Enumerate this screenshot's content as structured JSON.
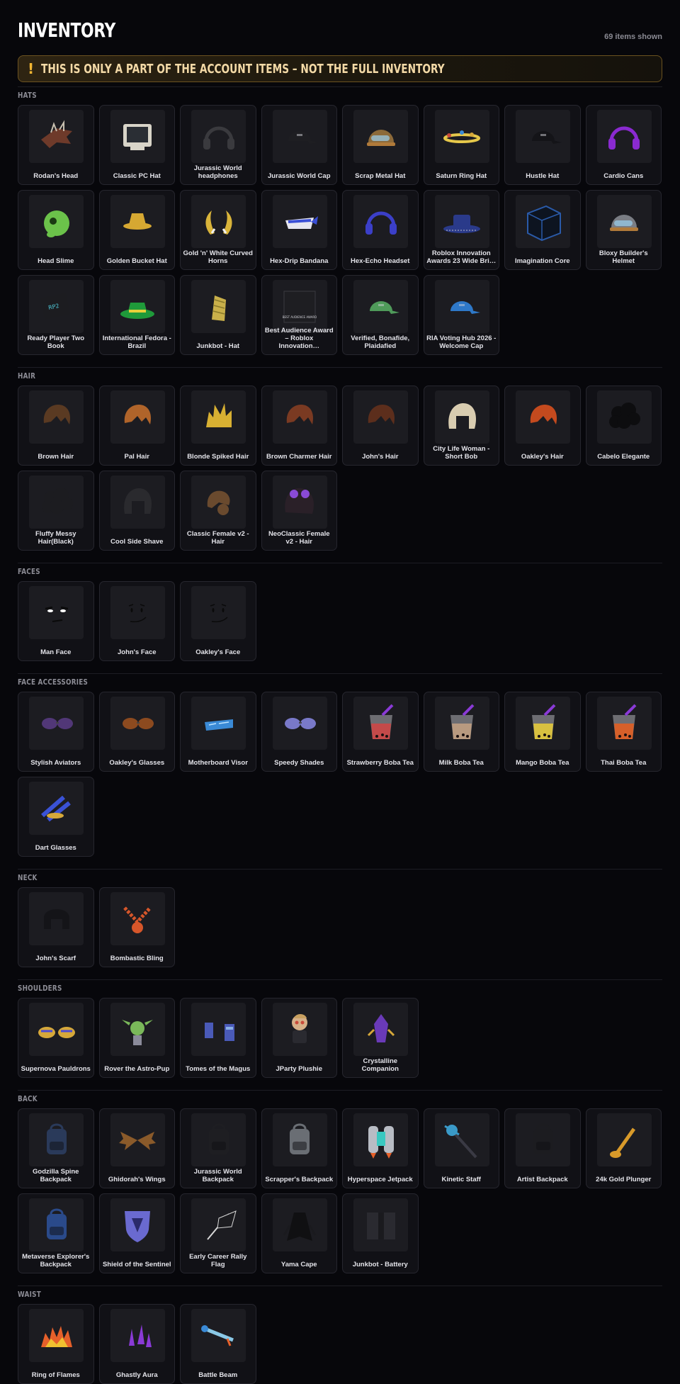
{
  "header": {
    "title": "INVENTORY",
    "count": "69 items shown"
  },
  "warning": {
    "icon": "exclamation-icon",
    "mark": "!",
    "text": "THIS IS ONLY A PART OF THE ACCOUNT ITEMS – NOT THE FULL INVENTORY",
    "accent": "#f2b632"
  },
  "sections": [
    {
      "label": "HATS",
      "items": [
        {
          "name": "Rodan's Head",
          "icon": "creature-head",
          "color": "#6e3a2a"
        },
        {
          "name": "Classic PC Hat",
          "icon": "monitor",
          "color": "#d8d4c8"
        },
        {
          "name": "Jurassic World headphones",
          "icon": "headphones",
          "color": "#3a3a3e"
        },
        {
          "name": "Jurassic World Cap",
          "icon": "cap",
          "color": "#1e1e22"
        },
        {
          "name": "Scrap Metal Hat",
          "icon": "helmet",
          "color": "#8c6a3a"
        },
        {
          "name": "Saturn Ring Hat",
          "icon": "ring",
          "color": "#e6c84a"
        },
        {
          "name": "Hustle Hat",
          "icon": "cap",
          "color": "#141418"
        },
        {
          "name": "Cardio Cans",
          "icon": "headphones",
          "color": "#8a2ad0"
        },
        {
          "name": "Head Slime",
          "icon": "blob",
          "color": "#6bc24a"
        },
        {
          "name": "Golden Bucket Hat",
          "icon": "bucket-hat",
          "color": "#d6a832"
        },
        {
          "name": "Gold 'n' White Curved Horns",
          "icon": "horns",
          "color": "#d9b43a"
        },
        {
          "name": "Hex-Drip Bandana",
          "icon": "bandana",
          "color": "#3a4fd6"
        },
        {
          "name": "Hex-Echo Headset",
          "icon": "headphones",
          "color": "#3b3fc8"
        },
        {
          "name": "Roblox Innovation Awards 23 Wide Bri…",
          "icon": "wide-hat",
          "color": "#2a3a8a"
        },
        {
          "name": "Imagination Core",
          "icon": "cube",
          "color": "#2a5aa8"
        },
        {
          "name": "Bloxy Builder's Helmet",
          "icon": "helmet",
          "color": "#7a7d84"
        },
        {
          "name": "Ready Player Two Book",
          "icon": "book",
          "color": "#4ec7d6"
        },
        {
          "name": "International Fedora - Brazil",
          "icon": "fedora",
          "color": "#1f9a3a"
        },
        {
          "name": "Junkbot - Hat",
          "icon": "junk-hat",
          "color": "#c9b04a"
        },
        {
          "name": "Best Audience Award – Roblox Innovation…",
          "icon": "award-box",
          "color": "#1e1e22"
        },
        {
          "name": "Verified, Bonafide, Plaidafied",
          "icon": "cap",
          "color": "#4f9a5a"
        },
        {
          "name": "RIA Voting Hub 2026 - Welcome Cap",
          "icon": "cap",
          "color": "#2e78c8"
        }
      ]
    },
    {
      "label": "HAIR",
      "items": [
        {
          "name": "Brown Hair",
          "icon": "hair",
          "color": "#5a3a22"
        },
        {
          "name": "Pal Hair",
          "icon": "hair",
          "color": "#b0642a"
        },
        {
          "name": "Blonde Spiked Hair",
          "icon": "hair-spiked",
          "color": "#d8b032"
        },
        {
          "name": "Brown Charmer Hair",
          "icon": "hair",
          "color": "#7a3a22"
        },
        {
          "name": "John's Hair",
          "icon": "hair",
          "color": "#5c2e1c"
        },
        {
          "name": "City Life Woman - Short Bob",
          "icon": "hair-bob",
          "color": "#d8ccb0"
        },
        {
          "name": "Oakley's Hair",
          "icon": "hair",
          "color": "#c44a1e"
        },
        {
          "name": "Cabelo Elegante",
          "icon": "hair-curly",
          "color": "#0d0d0f"
        },
        {
          "name": "Fluffy Messy Hair(Black)",
          "icon": "hair-curly",
          "color": "#1c1c20"
        },
        {
          "name": "Cool Side Shave",
          "icon": "hair-bob",
          "color": "#2a2a2e"
        },
        {
          "name": "Classic Female v2 - Hair",
          "icon": "hair-bun",
          "color": "#6a4a2e"
        },
        {
          "name": "NeoClassic Female v2 - Hair",
          "icon": "hair-glasses",
          "color": "#2a2028"
        }
      ]
    },
    {
      "label": "FACES",
      "items": [
        {
          "name": "Man Face",
          "icon": "face-man",
          "color": "#0e0e10"
        },
        {
          "name": "John's Face",
          "icon": "face-smile",
          "color": "#0e0e10"
        },
        {
          "name": "Oakley's Face",
          "icon": "face-smile",
          "color": "#0e0e10"
        }
      ]
    },
    {
      "label": "FACE ACCESSORIES",
      "items": [
        {
          "name": "Stylish Aviators",
          "icon": "glasses",
          "color": "#5a3c86"
        },
        {
          "name": "Oakley's Glasses",
          "icon": "glasses",
          "color": "#a0521e"
        },
        {
          "name": "Motherboard Visor",
          "icon": "visor",
          "color": "#3a8ad6"
        },
        {
          "name": "Speedy Shades",
          "icon": "glasses",
          "color": "#8a8ae6"
        },
        {
          "name": "Strawberry Boba Tea",
          "icon": "boba",
          "color": "#c44a4a"
        },
        {
          "name": "Milk Boba Tea",
          "icon": "boba",
          "color": "#b89a80"
        },
        {
          "name": "Mango Boba Tea",
          "icon": "boba",
          "color": "#d8c040"
        },
        {
          "name": "Thai Boba Tea",
          "icon": "boba",
          "color": "#d6602a"
        },
        {
          "name": "Dart Glasses",
          "icon": "darts",
          "color": "#3a52d6"
        }
      ]
    },
    {
      "label": "NECK",
      "items": [
        {
          "name": "John's Scarf",
          "icon": "scarf",
          "color": "#141418"
        },
        {
          "name": "Bombastic Bling",
          "icon": "chain",
          "color": "#d6562a"
        }
      ]
    },
    {
      "label": "SHOULDERS",
      "items": [
        {
          "name": "Supernova Pauldrons",
          "icon": "pauldrons",
          "color": "#d6a83a"
        },
        {
          "name": "Rover the Astro-Pup",
          "icon": "pet",
          "color": "#7ab85a"
        },
        {
          "name": "Tomes of the Magus",
          "icon": "books",
          "color": "#4a5ab8"
        },
        {
          "name": "JParty Plushie",
          "icon": "plushie",
          "color": "#c8a060"
        },
        {
          "name": "Crystalline Companion",
          "icon": "crystal-pet",
          "color": "#6a3ab8"
        }
      ]
    },
    {
      "label": "BACK",
      "items": [
        {
          "name": "Godzilla Spine Backpack",
          "icon": "backpack",
          "color": "#2a3a5a"
        },
        {
          "name": "Ghidorah's Wings",
          "icon": "wings",
          "color": "#8a5a2a"
        },
        {
          "name": "Jurassic World Backpack",
          "icon": "backpack",
          "color": "#1e1e22"
        },
        {
          "name": "Scrapper's Backpack",
          "icon": "backpack",
          "color": "#6a6e74"
        },
        {
          "name": "Hyperspace Jetpack",
          "icon": "jetpack",
          "color": "#b8bcc4"
        },
        {
          "name": "Kinetic Staff",
          "icon": "staff",
          "color": "#3a9ac8"
        },
        {
          "name": "Artist Backpack",
          "icon": "backpack",
          "color": "#1c1c20"
        },
        {
          "name": "24k Gold Plunger",
          "icon": "plunger",
          "color": "#d89a2a"
        },
        {
          "name": "Metaverse Explorer's Backpack",
          "icon": "backpack",
          "color": "#2a4a8a"
        },
        {
          "name": "Shield of the Sentinel",
          "icon": "shield",
          "color": "#6a6ad0"
        },
        {
          "name": "Early Career Rally Flag",
          "icon": "flag",
          "color": "#d8d8d8"
        },
        {
          "name": "Yama Cape",
          "icon": "cape",
          "color": "#101012"
        },
        {
          "name": "Junkbot - Battery",
          "icon": "battery",
          "color": "#1a1a1e"
        }
      ]
    },
    {
      "label": "WAIST",
      "items": [
        {
          "name": "Ring of Flames",
          "icon": "flames",
          "color": "#e6602a"
        },
        {
          "name": "Ghastly Aura",
          "icon": "aura",
          "color": "#8a3ad6"
        },
        {
          "name": "Battle Beam",
          "icon": "beam",
          "color": "#8ac8e6"
        }
      ]
    }
  ]
}
